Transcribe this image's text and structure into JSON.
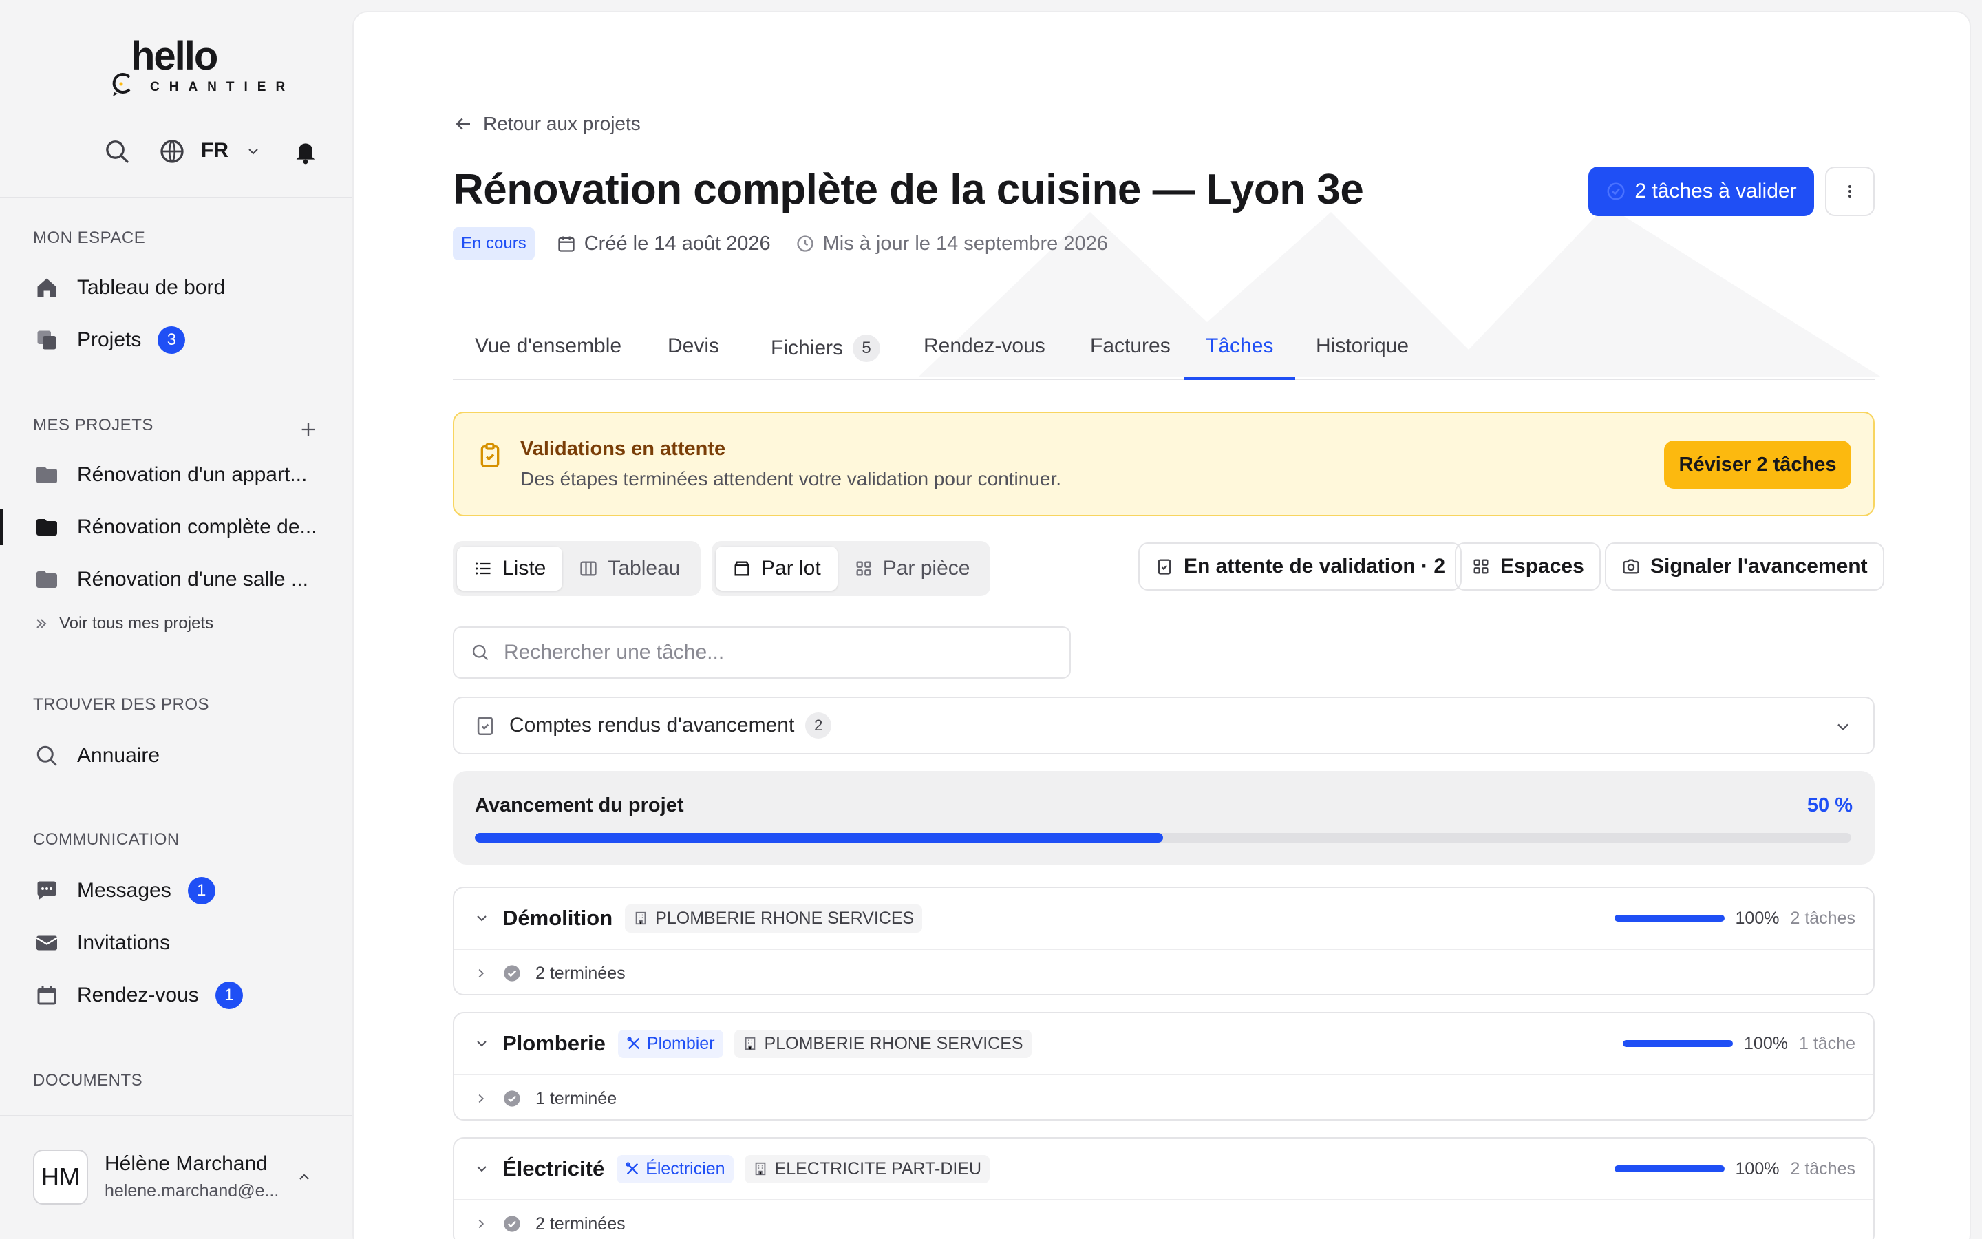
{
  "brand": {
    "logo_top": "hello",
    "logo_bottom": "CHANTIER"
  },
  "topbar": {
    "language": "FR"
  },
  "sidebar": {
    "sections": {
      "mon_espace": "MON ESPACE",
      "mes_projets": "MES PROJETS",
      "trouver": "TROUVER DES PROS",
      "communication": "COMMUNICATION",
      "documents": "DOCUMENTS"
    },
    "mon_espace": [
      {
        "label": "Tableau de bord",
        "icon": "home-icon"
      },
      {
        "label": "Projets",
        "icon": "projects-icon",
        "badge": "3"
      }
    ],
    "projets": [
      {
        "label": "Rénovation d'un appart..."
      },
      {
        "label": "Rénovation complète de..."
      },
      {
        "label": "Rénovation d'une salle ..."
      }
    ],
    "voir_tous": "Voir tous mes projets",
    "trouver": [
      {
        "label": "Annuaire",
        "icon": "search-icon"
      }
    ],
    "communication": [
      {
        "label": "Messages",
        "icon": "chat-icon",
        "badge": "1"
      },
      {
        "label": "Invitations",
        "icon": "mail-icon"
      },
      {
        "label": "Rendez-vous",
        "icon": "calendar-icon",
        "badge": "1"
      }
    ],
    "user": {
      "initials": "HM",
      "name": "Hélène Marchand",
      "email": "helene.marchand@e..."
    }
  },
  "project": {
    "back": "Retour aux projets",
    "title": "Rénovation complète de la cuisine — Lyon 3e",
    "status": "En cours",
    "created": "Créé le 14 août 2026",
    "updated": "Mis à jour le 14 septembre 2026",
    "validate_button": "2 tâches à valider"
  },
  "tabs": [
    {
      "label": "Vue d'ensemble"
    },
    {
      "label": "Devis"
    },
    {
      "label": "Fichiers",
      "count": "5"
    },
    {
      "label": "Rendez-vous"
    },
    {
      "label": "Factures"
    },
    {
      "label": "Tâches",
      "active": true
    },
    {
      "label": "Historique"
    }
  ],
  "alert": {
    "title": "Validations en attente",
    "text": "Des étapes terminées attendent votre validation pour continuer.",
    "button": "Réviser 2 tâches"
  },
  "toolbar": {
    "view": {
      "list": "Liste",
      "board": "Tableau"
    },
    "group": {
      "lot": "Par lot",
      "room": "Par pièce"
    },
    "pending": "En attente de validation · 2",
    "spaces": "Espaces",
    "report": "Signaler l'avancement"
  },
  "search": {
    "placeholder": "Rechercher une tâche..."
  },
  "reports": {
    "label": "Comptes rendus d'avancement",
    "count": "2"
  },
  "progress": {
    "label": "Avancement du projet",
    "value_text": "50 %",
    "value": 0.5
  },
  "lots": [
    {
      "name": "Démolition",
      "trade": null,
      "company": "PLOMBERIE RHONE SERVICES",
      "pct": "100%",
      "progress": 1.0,
      "count": "2 tâches",
      "done": "2 terminées"
    },
    {
      "name": "Plomberie",
      "trade": "Plombier",
      "company": "PLOMBERIE RHONE SERVICES",
      "pct": "100%",
      "progress": 1.0,
      "count": "1 tâche",
      "done": "1 terminée"
    },
    {
      "name": "Électricité",
      "trade": "Électricien",
      "company": "ELECTRICITE PART-DIEU",
      "pct": "100%",
      "progress": 1.0,
      "count": "2 tâches",
      "done": "2 terminées"
    }
  ],
  "colors": {
    "accent": "#1f4ff5",
    "warning_bg": "#fff8db",
    "warning_button": "#fcb90f"
  }
}
